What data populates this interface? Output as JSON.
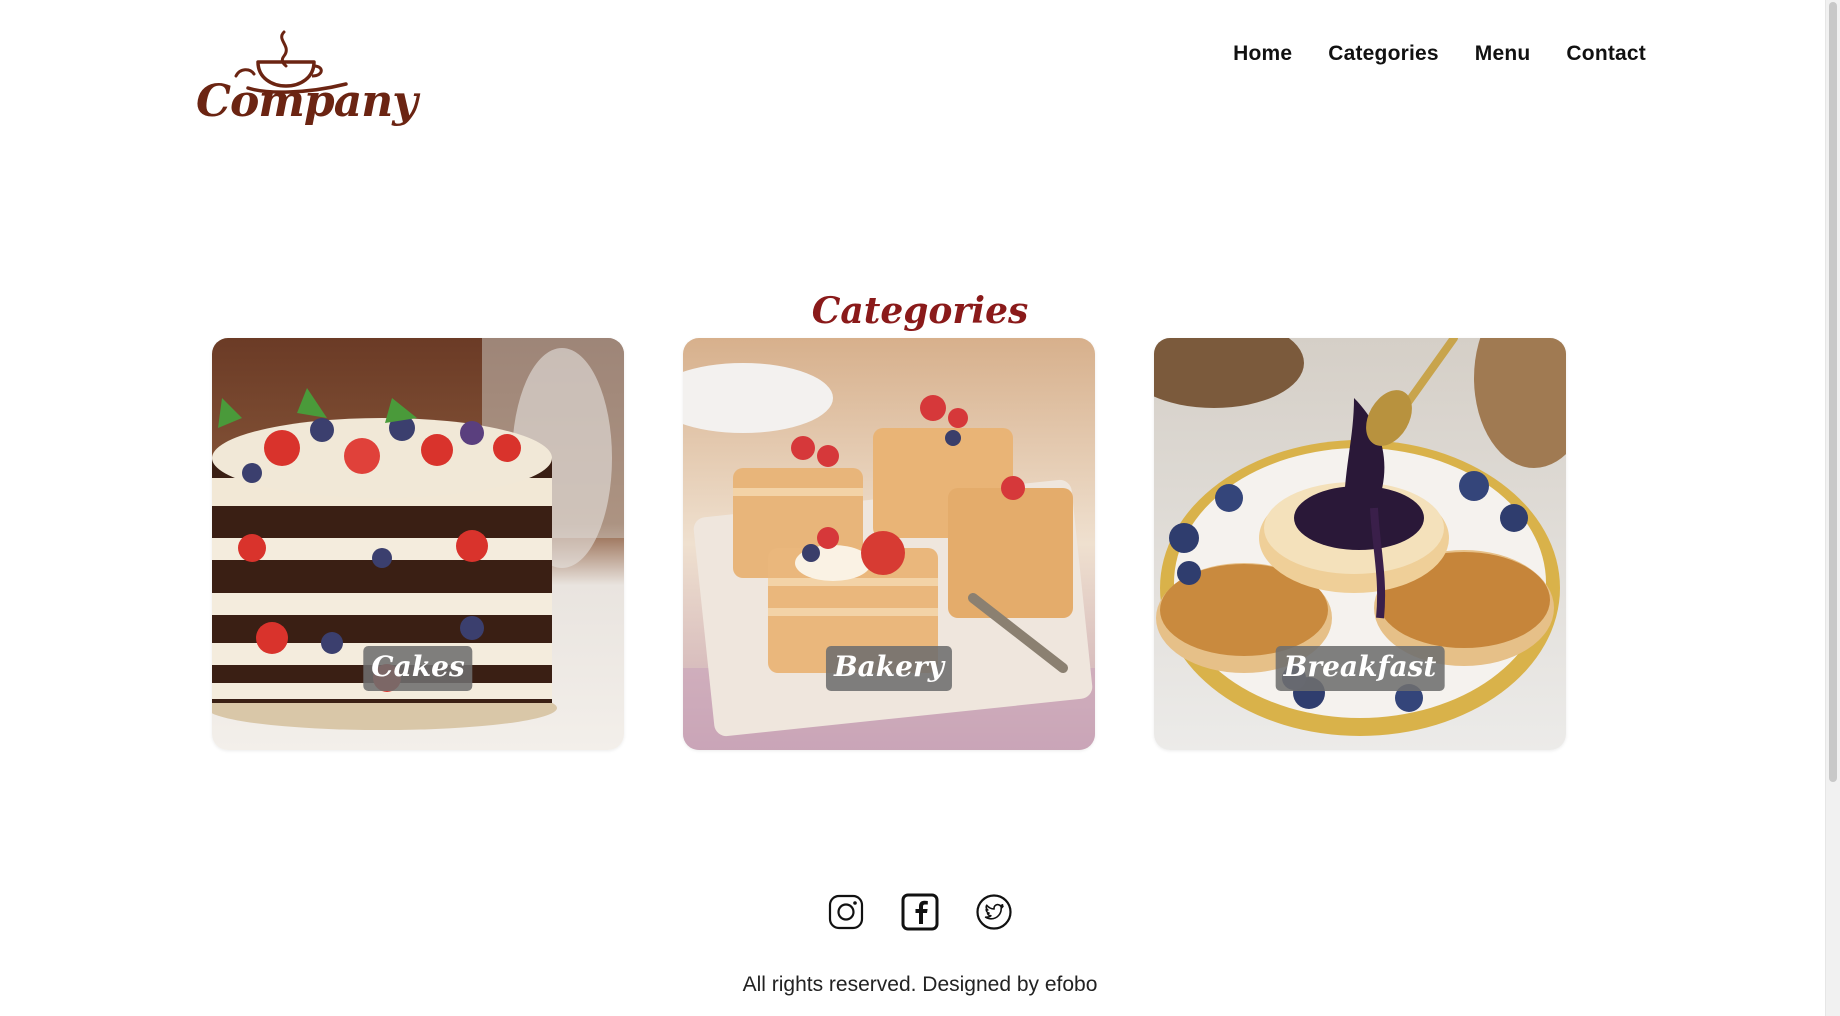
{
  "brand": {
    "logo_text": "Company",
    "logo_color": "#6b2412"
  },
  "nav": {
    "items": [
      {
        "label": "Home"
      },
      {
        "label": "Categories"
      },
      {
        "label": "Menu"
      },
      {
        "label": "Contact"
      }
    ]
  },
  "categories": {
    "title": "Categories",
    "title_color": "#8a1a1a",
    "cards": [
      {
        "label": "Cakes",
        "image": "layered-berry-cake-photo"
      },
      {
        "label": "Bakery",
        "image": "puff-pastry-berry-tarts-photo"
      },
      {
        "label": "Breakfast",
        "image": "pancakes-blueberry-sauce-photo"
      }
    ]
  },
  "footer": {
    "social_icons": [
      "instagram-icon",
      "facebook-icon",
      "twitter-icon"
    ],
    "copyright": "All rights reserved. Designed by efobo"
  }
}
